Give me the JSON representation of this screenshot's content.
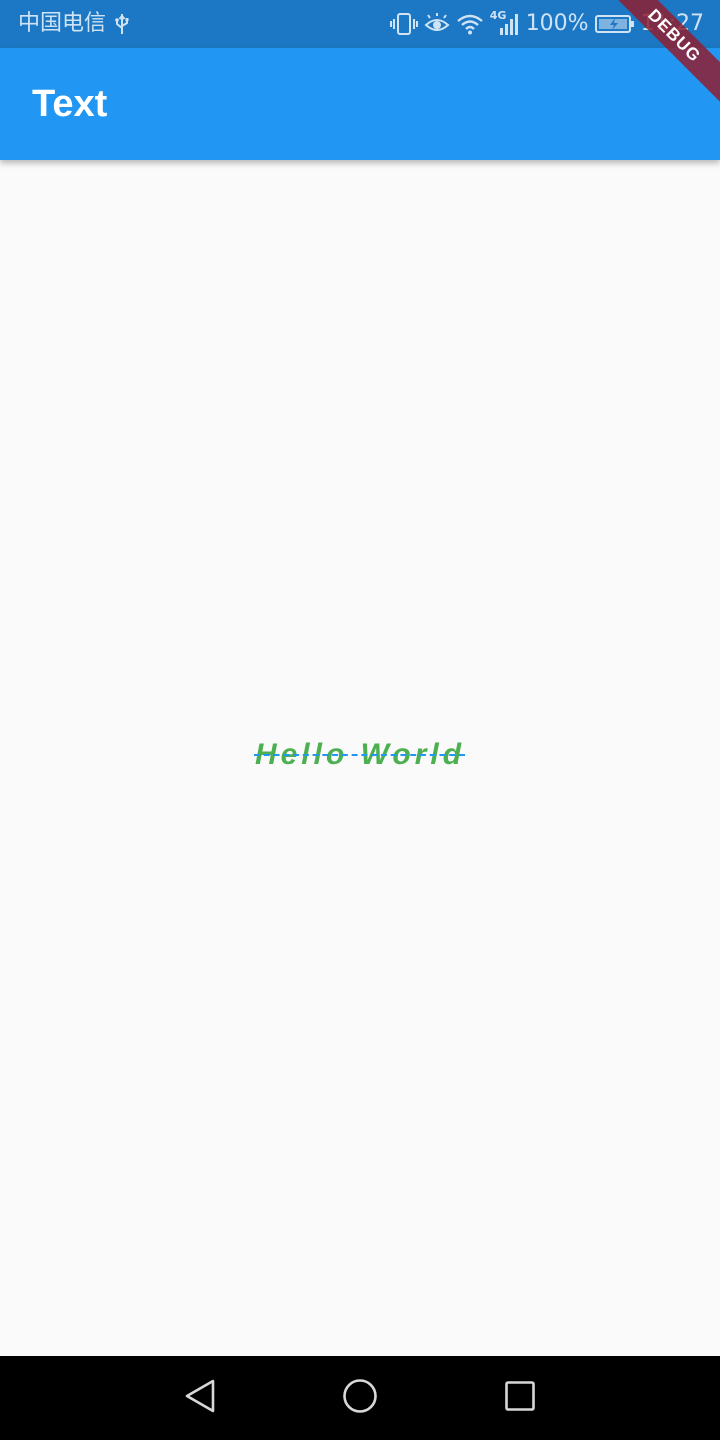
{
  "status_bar": {
    "carrier": "中国电信",
    "battery_percent": "100%",
    "time": "11:27",
    "network_type": "4G",
    "icons": [
      "usb-icon",
      "vibrate-icon",
      "eye-comfort-icon",
      "wifi-icon",
      "signal-icon",
      "battery-charging-icon"
    ]
  },
  "app_bar": {
    "title": "Text"
  },
  "debug_banner": {
    "label": "DEBUG"
  },
  "content": {
    "text": "Hello World",
    "text_color": "#4caf50",
    "decoration_color": "#2196f3"
  },
  "nav_bar": {
    "buttons": [
      "back-icon",
      "home-icon",
      "recents-icon"
    ]
  },
  "colors": {
    "status_bar": "#1c78c5",
    "app_bar": "#2196f3",
    "background": "#fafafa",
    "debug_banner": "#8e1e30",
    "nav_bar": "#000000"
  }
}
